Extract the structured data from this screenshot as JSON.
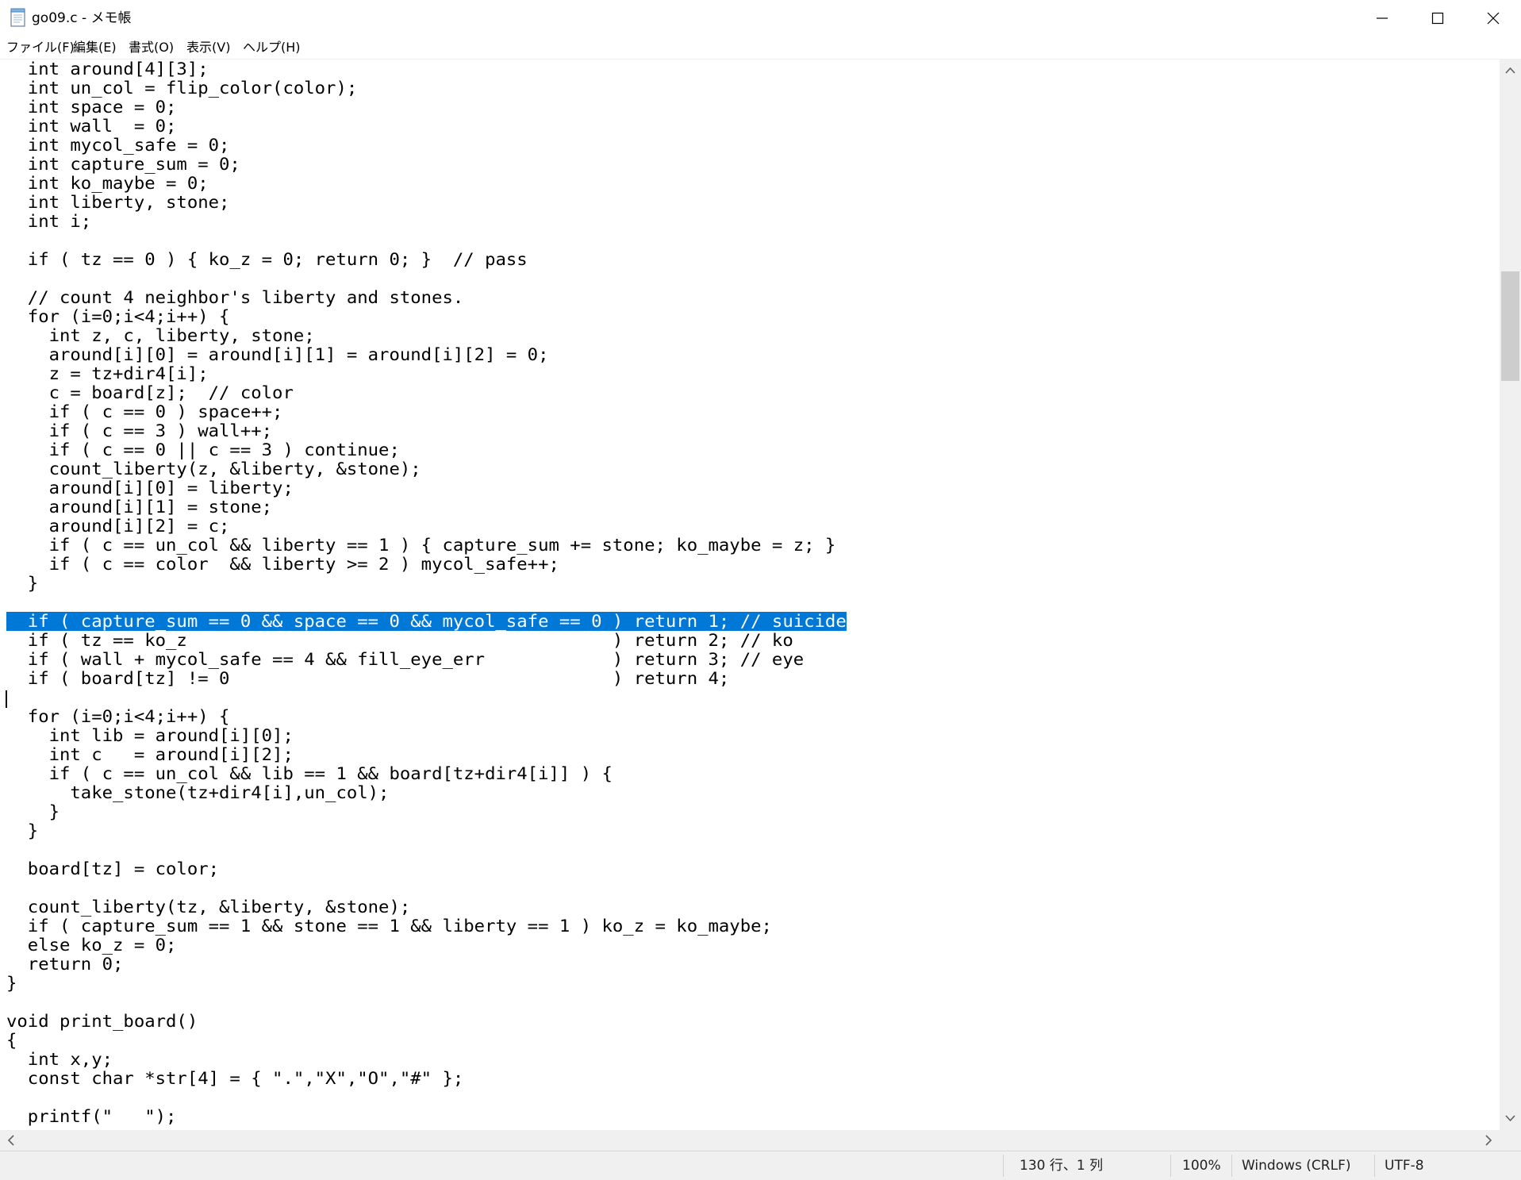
{
  "window": {
    "title": "go09.c - メモ帳",
    "icon": "notepad-icon",
    "controls": [
      "minimize-icon",
      "maximize-icon",
      "close-icon"
    ]
  },
  "menu": [
    "ファイル(F)",
    "編集(E)",
    "書式(O)",
    "表示(V)",
    "ヘルプ(H)"
  ],
  "editor": {
    "selection_color": "#0078d7",
    "lines": [
      "  int around[4][3];",
      "  int un_col = flip_color(color);",
      "  int space = 0;",
      "  int wall  = 0;",
      "  int mycol_safe = 0;",
      "  int capture_sum = 0;",
      "  int ko_maybe = 0;",
      "  int liberty, stone;",
      "  int i;",
      "",
      "  if ( tz == 0 ) { ko_z = 0; return 0; }  // pass",
      "",
      "  // count 4 neighbor's liberty and stones.",
      "  for (i=0;i<4;i++) {",
      "    int z, c, liberty, stone;",
      "    around[i][0] = around[i][1] = around[i][2] = 0;",
      "    z = tz+dir4[i];",
      "    c = board[z];  // color",
      "    if ( c == 0 ) space++;",
      "    if ( c == 3 ) wall++;",
      "    if ( c == 0 || c == 3 ) continue;",
      "    count_liberty(z, &liberty, &stone);",
      "    around[i][0] = liberty;",
      "    around[i][1] = stone;",
      "    around[i][2] = c;",
      "    if ( c == un_col && liberty == 1 ) { capture_sum += stone; ko_maybe = z; }",
      "    if ( c == color  && liberty >= 2 ) mycol_safe++;",
      "  }",
      "",
      "  if ( capture_sum == 0 && space == 0 && mycol_safe == 0 ) return 1; // suicide",
      "  if ( tz == ko_z                                        ) return 2; // ko",
      "  if ( wall + mycol_safe == 4 && fill_eye_err            ) return 3; // eye",
      "  if ( board[tz] != 0                                    ) return 4;",
      "",
      "  for (i=0;i<4;i++) {",
      "    int lib = around[i][0];",
      "    int c   = around[i][2];",
      "    if ( c == un_col && lib == 1 && board[tz+dir4[i]] ) {",
      "      take_stone(tz+dir4[i],un_col);",
      "    }",
      "  }",
      "",
      "  board[tz] = color;",
      "",
      "  count_liberty(tz, &liberty, &stone);",
      "  if ( capture_sum == 1 && stone == 1 && liberty == 1 ) ko_z = ko_maybe;",
      "  else ko_z = 0;",
      "  return 0;",
      "}",
      "",
      "void print_board()",
      "{",
      "  int x,y;",
      "  const char *str[4] = { \".\",\"X\",\"O\",\"#\" };",
      "",
      "  printf(\"   \");"
    ]
  },
  "statusbar": {
    "position": "130 行、1 列",
    "zoom": "100%",
    "line_ending": "Windows (CRLF)",
    "encoding": "UTF-8"
  }
}
